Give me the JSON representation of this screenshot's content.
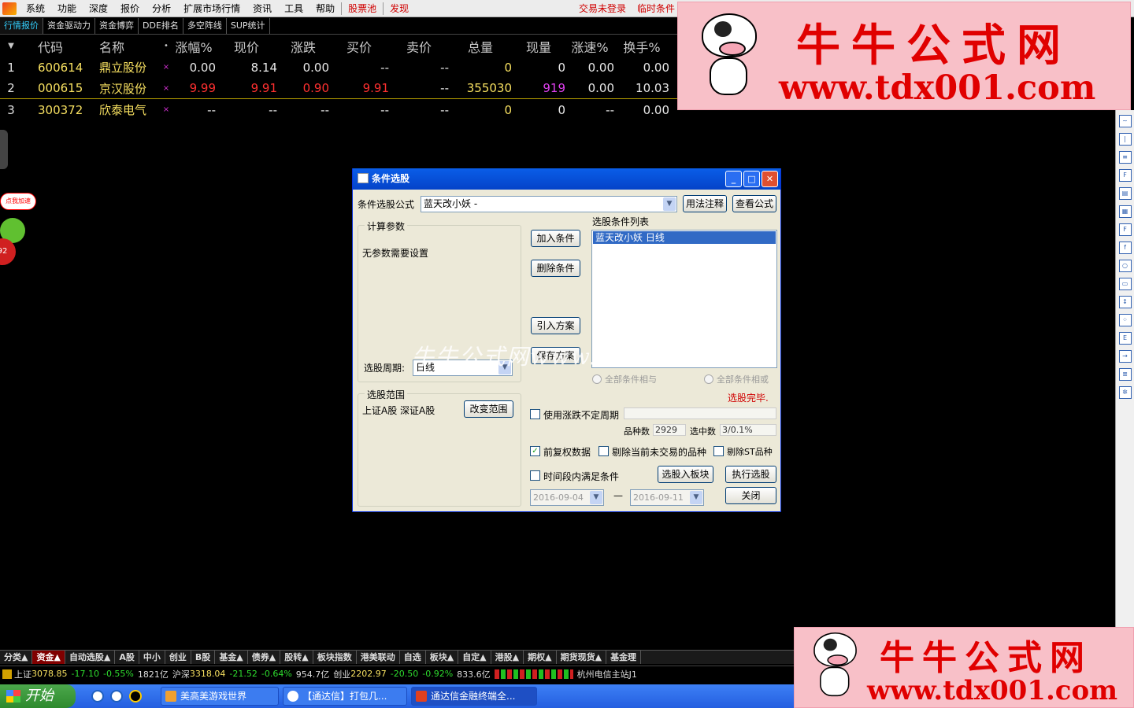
{
  "menubar": {
    "items": [
      "系统",
      "功能",
      "深度",
      "报价",
      "分析",
      "扩展市场行情",
      "资讯",
      "工具",
      "帮助",
      "股票池",
      "发现"
    ],
    "right": [
      "交易未登录",
      "临时条件"
    ]
  },
  "tabs": [
    "行情报价",
    "资金驱动力",
    "资金博弈",
    "DDE排名",
    "多空阵线",
    "SUP统计"
  ],
  "quote_header": [
    "代码",
    "名称",
    "涨幅%",
    "现价",
    "涨跌",
    "买价",
    "卖价",
    "总量",
    "现量",
    "涨速%",
    "换手%"
  ],
  "quotes": [
    {
      "idx": "1",
      "code": "600614",
      "name": "鼎立股份",
      "mark": "×",
      "pct": "0.00",
      "price": "8.14",
      "chg": "0.00",
      "buy": "--",
      "sell": "--",
      "vol": "0",
      "cur": "0",
      "spd": "0.00",
      "turn": "0.00"
    },
    {
      "idx": "2",
      "code": "000615",
      "name": "京汉股份",
      "mark": "×",
      "pct": "9.99",
      "price": "9.91",
      "chg": "0.90",
      "buy": "9.91",
      "sell": "--",
      "vol": "355030",
      "cur": "919",
      "spd": "0.00",
      "turn": "10.03"
    },
    {
      "idx": "3",
      "code": "300372",
      "name": "欣泰电气",
      "mark": "×",
      "pct": "--",
      "price": "--",
      "chg": "--",
      "buy": "--",
      "sell": "--",
      "vol": "0",
      "cur": "0",
      "spd": "--",
      "turn": "0.00"
    }
  ],
  "left_widget": {
    "bubble": "点我加速",
    "num": "92"
  },
  "watermark": {
    "title": "牛牛公式网",
    "url": "www.tdx001.com",
    "inline": "牛牛公式网www.tdx001.com"
  },
  "dialog": {
    "title": "条件选股",
    "formula_label": "条件选股公式",
    "formula_value": "蓝天改小妖    -",
    "usage_btn": "用法注释",
    "view_btn": "查看公式",
    "params_group": "计算参数",
    "no_params": "无参数需要设置",
    "add_btn": "加入条件",
    "del_btn": "删除条件",
    "import_btn": "引入方案",
    "save_btn": "保存方案",
    "cond_list_label": "选股条件列表",
    "cond_items": [
      "蓝天改小妖    日线"
    ],
    "period_label": "选股周期:",
    "period_value": "日线",
    "all_and": "全部条件相与",
    "all_or": "全部条件相或",
    "done": "选股完毕.",
    "range_group": "选股范围",
    "range_value": "上证A股  深证A股",
    "change_range_btn": "改变范围",
    "use_period": "使用涨跌不定周期",
    "count_label": "品种数",
    "count_value": "2929",
    "selected_label": "选中数",
    "selected_value": "3/0.1%",
    "fq_label": "前复权数据",
    "exclude_label": "剔除当前未交易的品种",
    "st_label": "剔除ST品种",
    "time_label": "时间段内满足条件",
    "to_block_btn": "选股入板块",
    "exec_btn": "执行选股",
    "date_from": "2016-09-04",
    "date_to": "2016-09-11",
    "date_sep": "—",
    "close_btn": "关闭"
  },
  "bottom_tabs": [
    "分类▲",
    "资金▲",
    "自动选股▲",
    "A股",
    "中小",
    "创业",
    "B股",
    "基金▲",
    "债券▲",
    "股转▲",
    "板块指数",
    "港美联动",
    "自选",
    "板块▲",
    "自定▲",
    "港股▲",
    "期权▲",
    "期货现货▲",
    "基金理"
  ],
  "status": {
    "sh_label": "上证",
    "sh": "3078.85",
    "sh_chg": "-17.10",
    "sh_pct": "-0.55%",
    "sh_amt": "1821亿",
    "hs_label": "沪深",
    "hs": "3318.04",
    "hs_chg": "-21.52",
    "hs_pct": "-0.64%",
    "hs_amt": "954.7亿",
    "cy_label": "创业",
    "cy": "2202.97",
    "cy_chg": "-20.50",
    "cy_pct": "-0.92%",
    "cy_amt": "833.6亿",
    "station": "杭州电信主站J1"
  },
  "taskbar": {
    "start": "开始",
    "tasks": [
      "美高美游戏世界",
      "【通达信】打包几...",
      "通达信金融终端全..."
    ]
  },
  "colors": {
    "accent": "#0a5ee8",
    "up": "#ff3030",
    "code": "#f7e060",
    "watermark": "#e00000"
  }
}
